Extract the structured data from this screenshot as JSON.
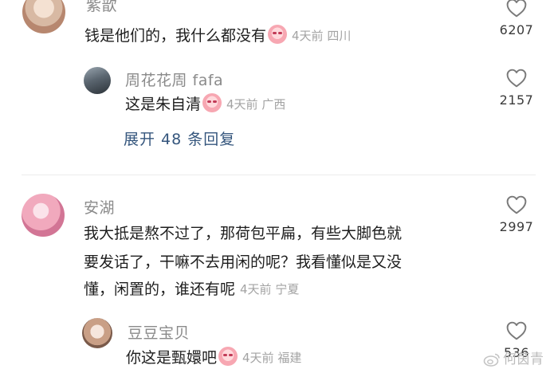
{
  "comments": [
    {
      "user": "紫歆",
      "text": "钱是他们的，我什么都没有",
      "time": "4天前",
      "location": "四川",
      "likes": "6207",
      "replies": [
        {
          "user": "周花花周 fafa",
          "text": "这是朱自清",
          "time": "4天前",
          "location": "广西",
          "likes": "2157"
        }
      ],
      "expand_label": "展开 48 条回复"
    },
    {
      "user": "安湖",
      "text_lines": [
        "我大抵是熬不过了，那荷包平扁，有些大脚色就",
        "要发话了，干嘛不去用闲的呢？我看懂似是又没",
        "懂，闲置的，谁还有呢"
      ],
      "time": "4天前",
      "location": "宁夏",
      "likes": "2997",
      "replies": [
        {
          "user": "豆豆宝贝",
          "text": "你这是甄嬛吧",
          "time": "4天前",
          "location": "福建",
          "likes": "536"
        }
      ]
    }
  ],
  "watermark": "何茵青",
  "icons": {
    "like": "heart-outline-icon",
    "emoji": "crying-face-emoji-icon"
  }
}
